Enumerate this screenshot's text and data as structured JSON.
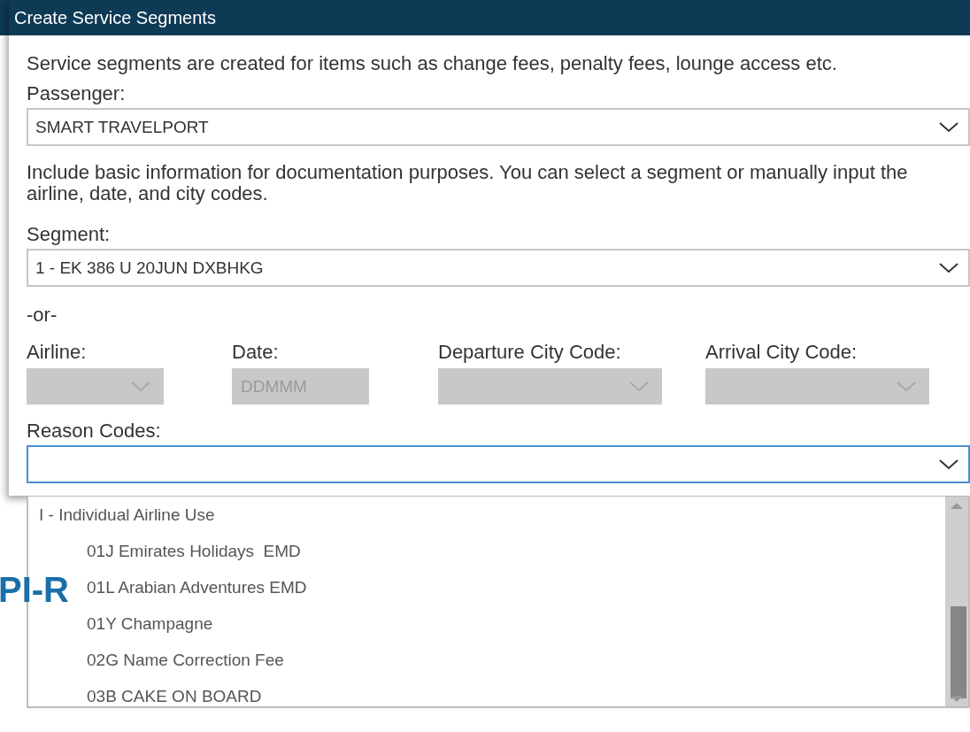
{
  "background": {
    "text": "PI-R"
  },
  "dialog": {
    "title": "Create Service Segments",
    "intro": "Service segments are created for items such as change fees, penalty fees, lounge access etc.",
    "passenger": {
      "label": "Passenger:",
      "value": "SMART TRAVELPORT"
    },
    "info": "Include basic information for documentation purposes. You can select a segment or manually input the airline, date, and city codes.",
    "segment": {
      "label": "Segment:",
      "value": "1 - EK 386 U 20JUN DXBHKG"
    },
    "or_text": "-or-",
    "manual_fields": [
      {
        "label": "Airline:",
        "kind": "dropdown",
        "disabled": true
      },
      {
        "label": "Date:",
        "kind": "text",
        "placeholder": "DDMMM",
        "disabled": true
      },
      {
        "label": "Departure City Code:",
        "kind": "dropdown",
        "disabled": true
      },
      {
        "label": "Arrival City Code:",
        "kind": "dropdown",
        "disabled": true
      }
    ],
    "reason_codes": {
      "label": "Reason Codes:",
      "expanded": true,
      "options": [
        {
          "kind": "group",
          "text": "I - Individual Airline Use"
        },
        {
          "kind": "option",
          "text": "01J Emirates Holidays  EMD"
        },
        {
          "kind": "option",
          "text": "01L Arabian Adventures EMD"
        },
        {
          "kind": "option",
          "text": "01Y Champagne"
        },
        {
          "kind": "option",
          "text": "02G Name Correction Fee"
        },
        {
          "kind": "option",
          "text": "03B CAKE ON BOARD"
        }
      ]
    }
  }
}
